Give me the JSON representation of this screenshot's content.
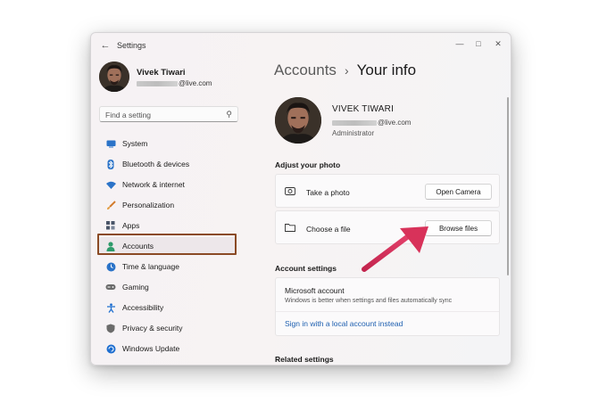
{
  "window": {
    "title": "Settings",
    "back_icon": "back-arrow-icon",
    "controls": [
      "minimize-icon",
      "maximize-icon",
      "close-icon"
    ]
  },
  "sidebar": {
    "user_name": "Vivek Tiwari",
    "user_email_suffix": "@live.com",
    "search_placeholder": "Find a setting",
    "items": [
      {
        "label": "System",
        "icon": "monitor-icon",
        "color": "#2b73c8"
      },
      {
        "label": "Bluetooth & devices",
        "icon": "bluetooth-icon",
        "color": "#2b73c8"
      },
      {
        "label": "Network & internet",
        "icon": "wifi-icon",
        "color": "#2b73c8"
      },
      {
        "label": "Personalization",
        "icon": "brush-icon",
        "color": "#d27a2a"
      },
      {
        "label": "Apps",
        "icon": "apps-icon",
        "color": "#4a5568"
      },
      {
        "label": "Accounts",
        "icon": "person-icon",
        "color": "#2e9a6a",
        "selected": true
      },
      {
        "label": "Time & language",
        "icon": "globe-clock-icon",
        "color": "#2b73c8"
      },
      {
        "label": "Gaming",
        "icon": "gamepad-icon",
        "color": "#6b6b6b"
      },
      {
        "label": "Accessibility",
        "icon": "accessibility-icon",
        "color": "#1f6fd0"
      },
      {
        "label": "Privacy & security",
        "icon": "shield-icon",
        "color": "#6b6b6b"
      },
      {
        "label": "Windows Update",
        "icon": "update-icon",
        "color": "#1f6fd0"
      }
    ]
  },
  "main": {
    "breadcrumb_parent": "Accounts",
    "breadcrumb_current": "Your info",
    "profile_name": "VIVEK TIWARI",
    "profile_email_suffix": "@live.com",
    "profile_role": "Administrator",
    "adjust_photo_heading": "Adjust your photo",
    "take_photo_label": "Take a photo",
    "open_camera_label": "Open Camera",
    "choose_file_label": "Choose a file",
    "browse_files_label": "Browse files",
    "account_settings_heading": "Account settings",
    "ms_account_title": "Microsoft account",
    "ms_account_subtitle": "Windows is better when settings and files automatically sync",
    "local_account_link": "Sign in with a local account instead",
    "related_settings_heading": "Related settings"
  },
  "colors": {
    "accent_link": "#1d5fb0",
    "highlight_box": "#8a4a25",
    "annotation_arrow": "#d8325a"
  }
}
